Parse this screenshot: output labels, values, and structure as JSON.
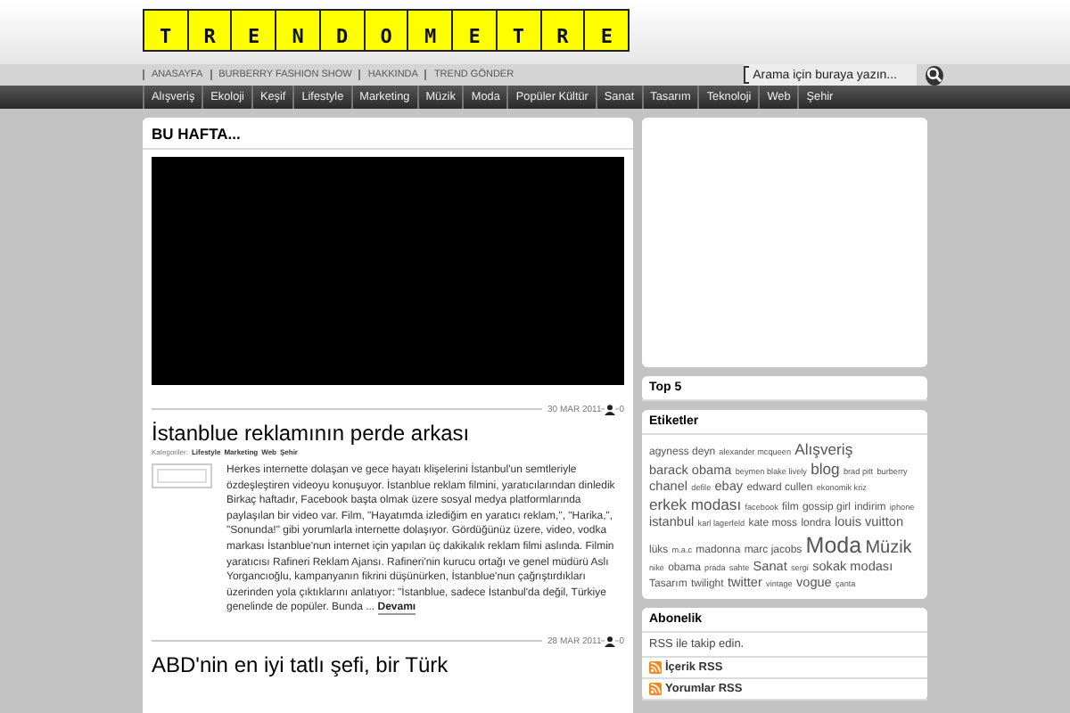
{
  "logo": {
    "letters": [
      "T",
      "R",
      "E",
      "N",
      "D",
      "O",
      "M",
      "E",
      "T",
      "R",
      "E"
    ]
  },
  "top_nav": [
    "ANASAYFA",
    "BURBERRY FASHION SHOW",
    "HAKKINDA",
    "TREND GÖNDER"
  ],
  "search": {
    "placeholder": "Arama için buraya yazın..."
  },
  "categories": [
    "Alışveriş",
    "Ekoloji",
    "Keşif",
    "Lifestyle",
    "Marketing",
    "Müzik",
    "Moda",
    "Popüler Kültür",
    "Sanat",
    "Tasarım",
    "Teknoloji",
    "Web",
    "Şehir"
  ],
  "featured": {
    "title": "BU HAFTA..."
  },
  "posts": [
    {
      "date": "30 MAR 2011",
      "comments": "0",
      "title": "İstanblue reklamının perde arkası",
      "categories_label": "Kategoriler:",
      "categories": [
        "Lifestyle",
        "Marketing",
        "Web",
        "Şehir"
      ],
      "excerpt": "Herkes internette dolaşan ve gece hayatı klişelerini İstanbul'un semtleriyle özdeşleştiren videoyu konuşuyor. İstanblue reklam filmini, yaratıcılarından dinledik Birkaç haftadır, Facebook başta olmak üzere sosyal medya platformlarında paylaşılan bir video var. Film, \"Hayatımda izlediğim en yaratıcı reklam,\", \"Harika,\", \"Sonunda!\" gibi yorumlarla internette dolaşıyor. Gördüğünüz üzere, video, vodka markası İstanblue'nun internet için yapılan üç dakikalık reklam filmi aslında. Filmin yaratıcısı Rafineri Reklam Ajansı. Rafineri'nin kurucu ortağı ve genel müdürü Aslı Yorgancıoğlu, kampanyanın fikrini düşünürken, İstanblue'nun çağrıştırdıkları üzerinden yola çıktıklarını anlatıyor: \"İstanblue, sadece İstanbul'da değil, Türkiye genelinde de popüler. Bunda ...",
      "more": "Devamı"
    },
    {
      "date": "28 MAR 2011",
      "comments": "0",
      "title": "ABD'nin en iyi tatlı şefi, bir Türk"
    }
  ],
  "sidebar": {
    "top5": {
      "title": "Top 5"
    },
    "tags": {
      "title": "Etiketler",
      "items": [
        {
          "text": "agyness deyn",
          "kind": "s2"
        },
        {
          "text": "alexander mcqueen",
          "kind": "s1"
        },
        {
          "text": "Alışveriş",
          "kind": "s4"
        },
        {
          "text": "barack obama",
          "kind": "s3"
        },
        {
          "text": "beymen blake lively",
          "kind": "s1"
        },
        {
          "text": "blog",
          "kind": "s4"
        },
        {
          "text": "brad pitt",
          "kind": "s1"
        },
        {
          "text": "burberry",
          "kind": "s1"
        },
        {
          "text": "chanel",
          "kind": "s3"
        },
        {
          "text": "defile",
          "kind": "s1"
        },
        {
          "text": "ebay",
          "kind": "s3"
        },
        {
          "text": "edward cullen",
          "kind": "s2"
        },
        {
          "text": "ekonomik kriz",
          "kind": "s1"
        },
        {
          "text": "erkek modası",
          "kind": "s4"
        },
        {
          "text": "facebook",
          "kind": "s1"
        },
        {
          "text": "film",
          "kind": "s2"
        },
        {
          "text": "gossip girl",
          "kind": "s2"
        },
        {
          "text": "indirim",
          "kind": "s2"
        },
        {
          "text": "iphone",
          "kind": "s1"
        },
        {
          "text": "istanbul",
          "kind": "s3"
        },
        {
          "text": "karl lagerfeld",
          "kind": "s1"
        },
        {
          "text": "kate moss",
          "kind": "s2"
        },
        {
          "text": "londra",
          "kind": "s2"
        },
        {
          "text": "louis vuitton",
          "kind": "s3"
        },
        {
          "text": "lüks",
          "kind": "s2"
        },
        {
          "text": "m.a.c",
          "kind": "s1"
        },
        {
          "text": "madonna",
          "kind": "s2"
        },
        {
          "text": "marc jacobs",
          "kind": "s2"
        },
        {
          "text": "Moda",
          "kind": "s5"
        },
        {
          "text": "Müzik",
          "kind": "s4b"
        },
        {
          "text": "nike",
          "kind": "s1"
        },
        {
          "text": "obama",
          "kind": "s2"
        },
        {
          "text": "prada",
          "kind": "s1"
        },
        {
          "text": "sahte",
          "kind": "s1"
        },
        {
          "text": "Sanat",
          "kind": "s3"
        },
        {
          "text": "sergi",
          "kind": "s1"
        },
        {
          "text": "sokak modası",
          "kind": "s3"
        },
        {
          "text": "Tasarım",
          "kind": "s2"
        },
        {
          "text": "twilight",
          "kind": "s2"
        },
        {
          "text": "twitter",
          "kind": "s3"
        },
        {
          "text": "vintage",
          "kind": "s1"
        },
        {
          "text": "vogue",
          "kind": "s3"
        },
        {
          "text": "çanta",
          "kind": "s1"
        }
      ]
    },
    "subscribe": {
      "title": "Abonelik",
      "text": "RSS ile takip edin.",
      "links": [
        "İçerik RSS",
        "Yorumlar RSS"
      ]
    }
  }
}
